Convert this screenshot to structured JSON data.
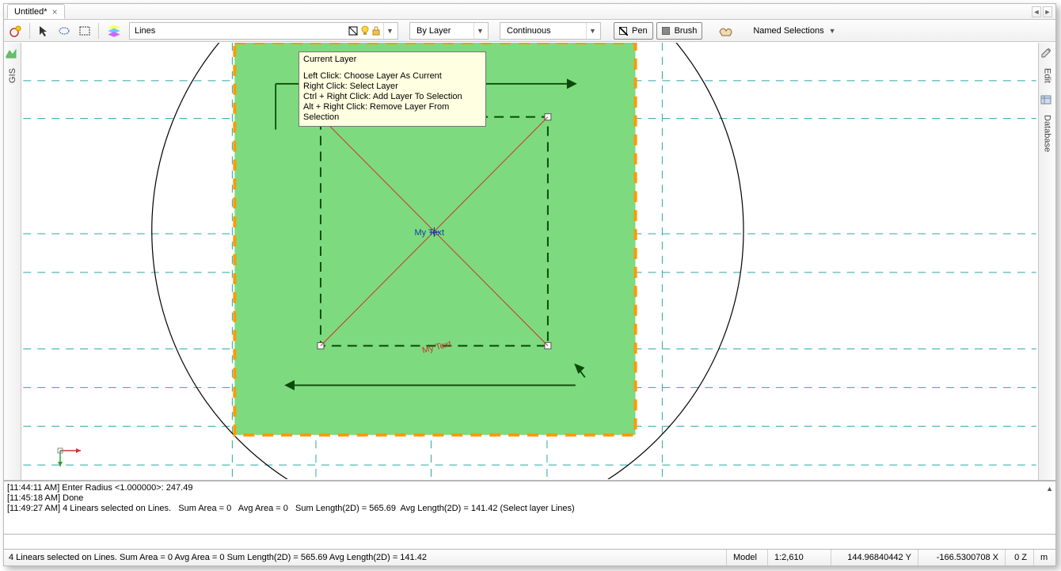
{
  "doc_tab": {
    "title": "Untitled*",
    "close_glyph": "×"
  },
  "toolbar": {
    "layer_name": "Lines",
    "color_combo": "By Layer",
    "linetype_combo": "Continuous",
    "pen_label": "Pen",
    "brush_label": "Brush",
    "named_selections": "Named Selections"
  },
  "side": {
    "left_tab": "GIS",
    "right_tab1": "Edit",
    "right_tab2": "Database"
  },
  "tooltip": {
    "title": "Current Layer",
    "line1": "Left Click: Choose Layer As Current",
    "line2": "Right Click: Select Layer",
    "line3": "Ctrl + Right Click: Add Layer To Selection",
    "line4": "Alt + Right Click: Remove Layer From Selection"
  },
  "canvas_text": {
    "center_label": "My Text",
    "angled_label": "My Text"
  },
  "cmdlog": {
    "l1": "[11:44:11 AM] Enter Radius <1.000000>: 247.49",
    "l2": "[11:45:18 AM] Done",
    "l3": "[11:49:27 AM] 4 Linears selected on Lines.   Sum Area = 0   Avg Area = 0   Sum Length(2D) = 565.69  Avg Length(2D) = 141.42 (Select layer Lines)"
  },
  "status": {
    "sel": "4 Linears selected on Lines.  Sum Area = 0  Avg Area = 0  Sum Length(2D) = 565.69  Avg Length(2D) = 141.42",
    "model": "Model",
    "scale": "1:2,610",
    "x": "144.96840442",
    "y": "-166.5300708",
    "x_lbl": "X",
    "y_lbl": "Y",
    "z": "0",
    "z_lbl": "Z",
    "units": "m"
  }
}
